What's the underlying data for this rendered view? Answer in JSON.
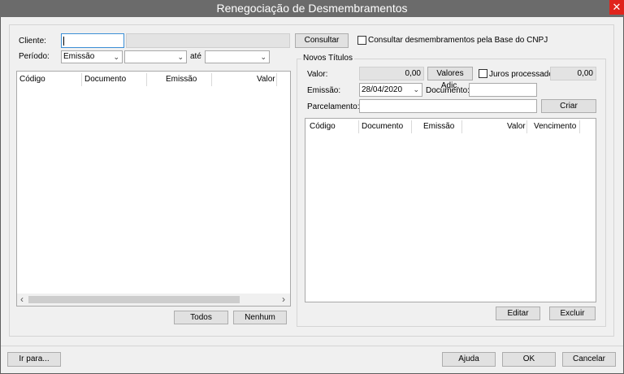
{
  "window": {
    "title": "Renegociação de Desmembramentos",
    "close_glyph": "✕"
  },
  "cliente": {
    "label": "Cliente:",
    "code_value": "",
    "name_value": "",
    "consultar_label": "Consultar",
    "cnpj_checkbox_label": "Consultar desmembramentos pela Base do CNPJ",
    "cnpj_checked": false
  },
  "periodo": {
    "label": "Período:",
    "type_value": "Emissão",
    "from_value": "",
    "ate_label": "até",
    "to_value": ""
  },
  "left_grid": {
    "columns": [
      "Código",
      "Documento",
      "Emissão",
      "Valor"
    ],
    "rows": [],
    "scroll_left": "‹",
    "scroll_right": "›"
  },
  "left_buttons": {
    "todos": "Todos",
    "nenhum": "Nenhum"
  },
  "novos_titulos": {
    "group_label": "Novos Títulos",
    "valor_label": "Valor:",
    "valor_value": "0,00",
    "valores_adic_label": "Valores Adic.",
    "juros_label": "Juros processados",
    "juros_checked": false,
    "juros_value": "0,00",
    "emissao_label": "Emissão:",
    "emissao_value": "28/04/2020",
    "documento_label": "Documento:",
    "documento_value": "",
    "parcelamento_label": "Parcelamento:",
    "parcelamento_value": "",
    "criar_label": "Criar",
    "grid_columns": [
      "Código",
      "Documento",
      "Emissão",
      "Valor",
      "Vencimento"
    ],
    "grid_rows": [],
    "editar_label": "Editar",
    "excluir_label": "Excluir"
  },
  "footer": {
    "ir_para": "Ir para...",
    "ajuda": "Ajuda",
    "ok": "OK",
    "cancelar": "Cancelar"
  },
  "icons": {
    "dropdown": "chevron-down-icon",
    "close": "close-icon"
  },
  "colors": {
    "titlebar": "#6b6b6b",
    "close": "#e0241c",
    "focus_border": "#3c8fd6"
  }
}
